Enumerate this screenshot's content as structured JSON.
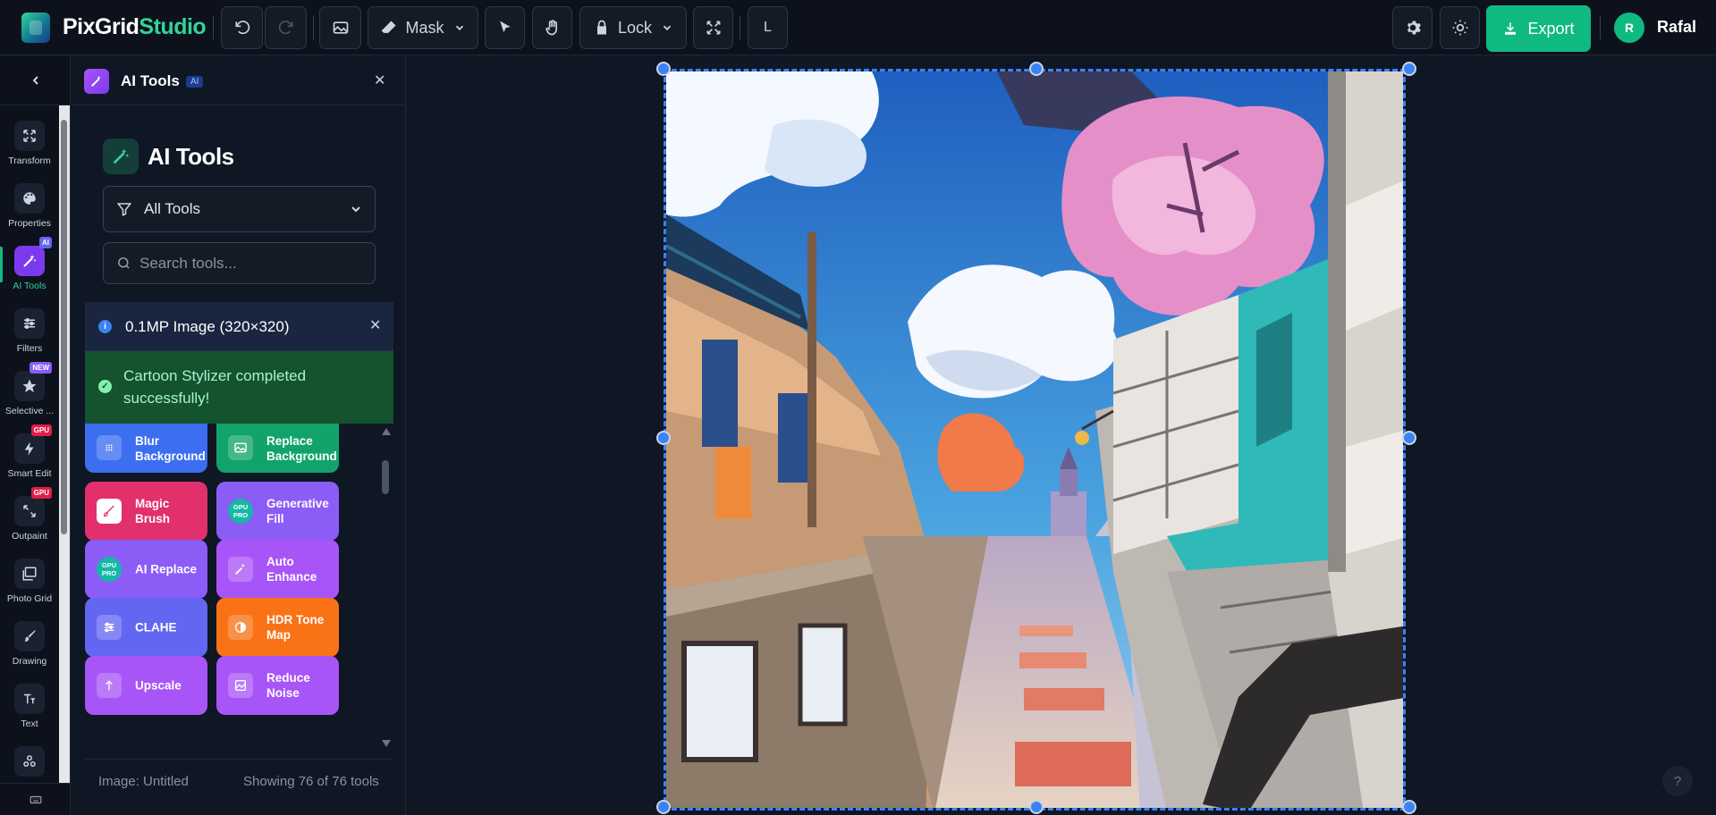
{
  "app": {
    "brand_main": "PixGrid",
    "brand_accent": "Studio",
    "accent_color": "#10b981"
  },
  "toolbar": {
    "undo_icon": "undo-icon",
    "redo_icon": "redo-icon",
    "image_icon": "image-icon",
    "mask_label": "Mask",
    "lock_label": "Lock",
    "layer_label": "L",
    "export_label": "Export",
    "user_initial": "R",
    "user_name": "Rafal"
  },
  "rail": {
    "items": [
      {
        "label": "Transform",
        "icon": "move-icon"
      },
      {
        "label": "Properties",
        "icon": "palette-icon"
      },
      {
        "label": "AI Tools",
        "icon": "magic-wand-icon",
        "badge": "AI",
        "active": true
      },
      {
        "label": "Filters",
        "icon": "sliders-icon"
      },
      {
        "label": "Selective ...",
        "icon": "star-icon",
        "badge": "NEW"
      },
      {
        "label": "Smart Edit",
        "icon": "bolt-icon",
        "badge": "GPU"
      },
      {
        "label": "Outpaint",
        "icon": "expand-icon",
        "badge": "GPU"
      },
      {
        "label": "Photo Grid",
        "icon": "photo-grid-icon"
      },
      {
        "label": "Drawing",
        "icon": "brush-icon"
      },
      {
        "label": "Text",
        "icon": "text-icon"
      }
    ]
  },
  "panel": {
    "header_title": "AI Tools",
    "header_badge": "AI",
    "title": "AI Tools",
    "filter_value": "All Tools",
    "search_placeholder": "Search tools...",
    "info_text": "0.1MP Image (320×320)",
    "success_text": "Cartoon Stylizer completed successfully!",
    "footer_left": "Image: Untitled",
    "footer_right": "Showing 76 of 76 tools"
  },
  "tools": [
    {
      "label": "Blur Background",
      "color": "#3b6ef0",
      "icon": "blur-icon"
    },
    {
      "label": "Replace Background",
      "color": "#12a36a",
      "icon": "image-icon"
    },
    {
      "label": "Magic Brush",
      "color": "#e1306c",
      "icon": "brush-icon"
    },
    {
      "label": "Generative Fill",
      "color": "#8b5cf6",
      "icon": "gpu-pro-badge",
      "badge": "GPU PRO"
    },
    {
      "label": "AI Replace",
      "color": "#8b5cf6",
      "icon": "gpu-pro-badge",
      "badge": "GPU PRO"
    },
    {
      "label": "Auto Enhance",
      "color": "#a855f7",
      "icon": "sparkles-icon"
    },
    {
      "label": "CLAHE",
      "color": "#6366f1",
      "icon": "sliders-icon"
    },
    {
      "label": "HDR Tone Map",
      "color": "#f97316",
      "icon": "contrast-icon"
    },
    {
      "label": "Upscale",
      "color": "#a855f7",
      "icon": "upscale-icon"
    },
    {
      "label": "Reduce Noise",
      "color": "#a855f7",
      "icon": "denoise-icon"
    }
  ],
  "help_label": "?"
}
